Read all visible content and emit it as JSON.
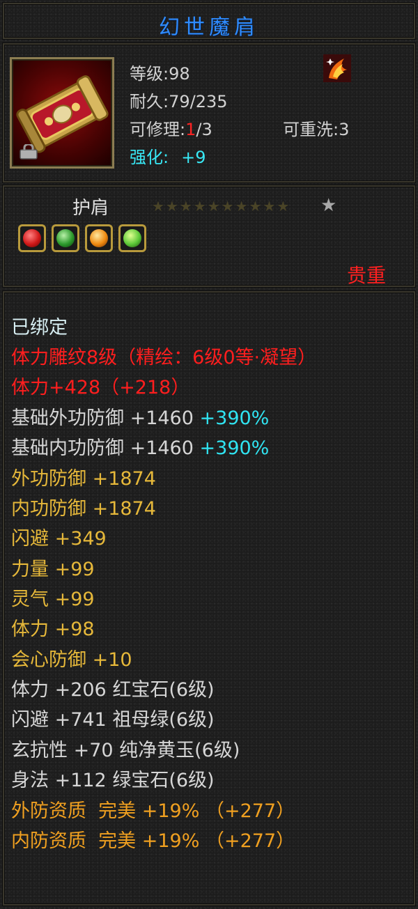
{
  "colors": {
    "title": "#2f8cff",
    "rarity": "#ff2020",
    "bound": "#d7eef2",
    "engrave": "#ff1e1e",
    "base": "#d6d6d6",
    "bonus": "#30e4f2",
    "attr": "#e6b83a",
    "quality": "#f0a020"
  },
  "item": {
    "name": "幻世魔肩",
    "icon": "golden-shoulder-armor-icon",
    "lock_icon": "lock-icon",
    "badge_icon": "fire-phoenix-badge-icon",
    "level_label": "等级:",
    "level": "98",
    "durability_label": "耐久:",
    "durability": "79/235",
    "repair_label": "可修理:",
    "repair_used": "1",
    "repair_total": "/3",
    "rewash_label": "可重洗:",
    "rewash": "3",
    "enhance_label": "强化:",
    "enhance": "+9"
  },
  "type": {
    "label": "护肩",
    "dim_stars": "★★★★★★★★★★",
    "star_count": 10,
    "lit_star": "★",
    "rarity": "贵重",
    "gems": [
      {
        "name": "red-gem-icon",
        "color": "#d01818"
      },
      {
        "name": "green-gem-icon",
        "color": "#2c9a2c"
      },
      {
        "name": "orange-gem-icon",
        "color": "#f08a10"
      },
      {
        "name": "light-green-gem-icon",
        "color": "#5cc838"
      }
    ]
  },
  "attributes": {
    "bound": "已绑定",
    "engrave": "体力雕纹8级（精绘：6级0等·凝望）",
    "stamina_bonus": "体力+428（+218）",
    "rows": [
      {
        "label": "基础外功防御 +1460",
        "extra": "+390%"
      },
      {
        "label": "基础内功防御 +1460",
        "extra": "+390%"
      },
      {
        "label": "外功防御 +1874"
      },
      {
        "label": "内功防御 +1874"
      },
      {
        "label": "闪避 +349"
      },
      {
        "label": "力量 +99"
      },
      {
        "label": "灵气 +99"
      },
      {
        "label": "体力 +98"
      },
      {
        "label": "会心防御 +10"
      }
    ],
    "gem_stats": [
      "体力 +206 红宝石(6级)",
      "闪避 +741 祖母绿(6级)",
      "玄抗性 +70 纯净黄玉(6级)",
      "身法 +112 绿宝石(6级)"
    ],
    "quality": [
      "外防资质  完美 +19% （+277）",
      "内防资质  完美 +19% （+277）"
    ]
  }
}
